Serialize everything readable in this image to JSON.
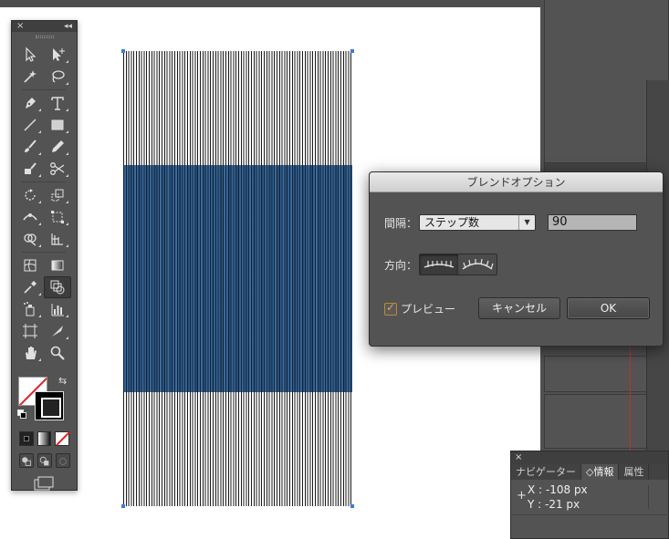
{
  "toolbox": {
    "close_glyph": "×",
    "collapse_glyph": "◂◂",
    "tools": [
      {
        "name": "selection-tool-icon"
      },
      {
        "name": "direct-selection-tool-icon"
      },
      {
        "name": "magic-wand-tool-icon"
      },
      {
        "name": "lasso-tool-icon"
      },
      {
        "name": "pen-tool-icon"
      },
      {
        "name": "type-tool-icon"
      },
      {
        "name": "line-segment-tool-icon"
      },
      {
        "name": "rectangle-tool-icon"
      },
      {
        "name": "paintbrush-tool-icon"
      },
      {
        "name": "pencil-tool-icon"
      },
      {
        "name": "blob-brush-tool-icon"
      },
      {
        "name": "scissors-tool-icon"
      },
      {
        "name": "rotate-tool-icon"
      },
      {
        "name": "scale-tool-icon"
      },
      {
        "name": "width-tool-icon"
      },
      {
        "name": "free-transform-tool-icon"
      },
      {
        "name": "shape-builder-tool-icon"
      },
      {
        "name": "perspective-grid-tool-icon"
      },
      {
        "name": "mesh-tool-icon"
      },
      {
        "name": "gradient-tool-icon"
      },
      {
        "name": "eyedropper-tool-icon"
      },
      {
        "name": "blend-tool-icon"
      },
      {
        "name": "symbol-sprayer-tool-icon"
      },
      {
        "name": "column-graph-tool-icon"
      },
      {
        "name": "artboard-tool-icon"
      },
      {
        "name": "slice-tool-icon"
      },
      {
        "name": "hand-tool-icon"
      },
      {
        "name": "zoom-tool-icon"
      }
    ],
    "colors": {
      "fill": "#ffffff",
      "stroke": "#000000"
    }
  },
  "dialog": {
    "title": "ブレンドオプション",
    "spacing_label": "間隔：",
    "spacing_value": "ステップ数",
    "spacing_arrow": "▼",
    "steps_value": "90",
    "orientation_label": "方向：",
    "preview_label": "プレビュー",
    "preview_checked": true,
    "cancel_label": "キャンセル",
    "ok_label": "OK"
  },
  "info_panel": {
    "close_glyph": "×",
    "tabs": [
      "ナビゲーター",
      "◇情報",
      "属性"
    ],
    "active_tab": "◇情報",
    "cross_glyph": "+",
    "x_readout": "X : -108 px",
    "y_readout": "Y : -21 px"
  },
  "artwork": {
    "stripe_color": "#1a1a1a",
    "selection_fill": "#2f5c8a",
    "anchor_color": "#3a7be0"
  }
}
